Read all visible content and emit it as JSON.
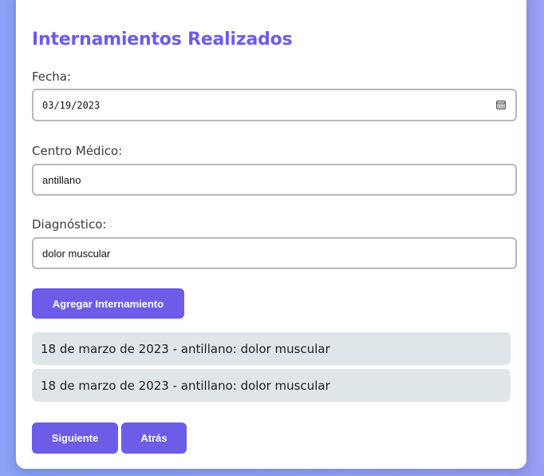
{
  "form": {
    "title": "Internamientos Realizados",
    "fecha_label": "Fecha:",
    "fecha_value": "03/19/2023",
    "centro_label": "Centro Médico:",
    "centro_value": "antillano",
    "diagnostico_label": "Diagnóstico:",
    "diagnostico_value": "dolor muscular",
    "add_button": "Agregar Internamiento"
  },
  "list": [
    "18 de marzo de 2023 - antillano: dolor muscular",
    "18 de marzo de 2023 - antillano: dolor muscular"
  ],
  "nav": {
    "next_button": "Siguiente",
    "back_button": "Atrás"
  },
  "colors": {
    "accent": "#6c5ce7",
    "list_bg": "#dfe6e9",
    "field_border": "#b3bac1"
  },
  "icons": {
    "date_picker": "calendar-icon"
  }
}
